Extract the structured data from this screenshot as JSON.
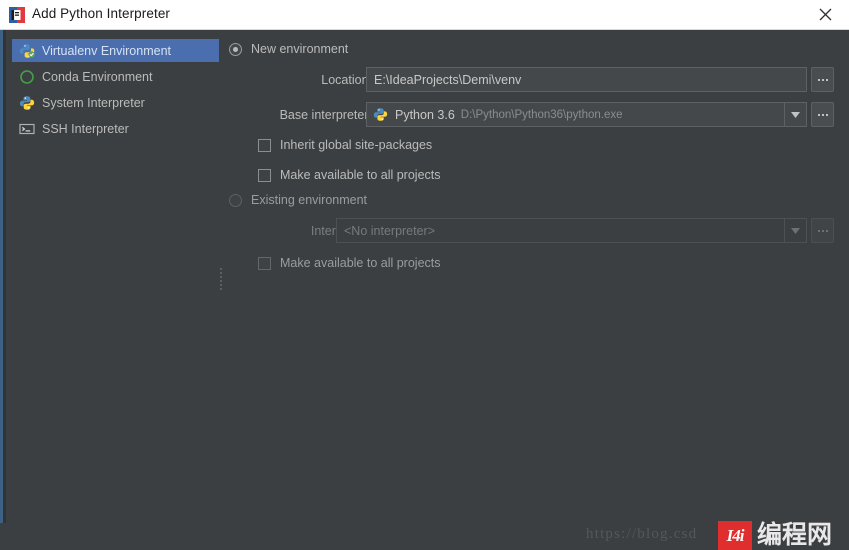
{
  "window": {
    "title": "Add Python Interpreter",
    "app_icon": "pycharm-icon",
    "close_label": "×"
  },
  "sidebar": {
    "items": [
      {
        "label": "Virtualenv Environment",
        "icon": "virtualenv-icon",
        "selected": true
      },
      {
        "label": "Conda Environment",
        "icon": "conda-icon",
        "selected": false
      },
      {
        "label": "System Interpreter",
        "icon": "python-icon",
        "selected": false
      },
      {
        "label": "SSH Interpreter",
        "icon": "ssh-terminal-icon",
        "selected": false
      }
    ]
  },
  "main": {
    "new_environment": {
      "radio_label": "New environment",
      "selected": true,
      "location": {
        "label": "Location:",
        "value": "E:\\IdeaProjects\\Demi\\venv",
        "browse_label": "..."
      },
      "base_interpreter": {
        "label": "Base interpreter:",
        "value": "Python 3.6",
        "path": "D:\\Python\\Python36\\python.exe",
        "icon": "python-icon",
        "browse_label": "..."
      },
      "checkboxes": [
        {
          "label": "Inherit global site-packages",
          "checked": false,
          "disabled": false
        },
        {
          "label": "Make available to all projects",
          "checked": false,
          "disabled": false
        }
      ]
    },
    "existing_environment": {
      "radio_label": "Existing environment",
      "selected": false,
      "interpreter": {
        "label": "Interpreter:",
        "value": "<No interpreter>",
        "browse_label": "..."
      },
      "checkboxes": [
        {
          "label": "Make available to all projects",
          "checked": false,
          "disabled": true
        }
      ]
    }
  },
  "watermark": {
    "url": "https://blog.csd",
    "logo_text": "I4i",
    "site_name": "编程网"
  },
  "colors": {
    "window_bg": "#3c3f41",
    "titlebar_bg": "#ffffff",
    "selection_blue": "#4b6eaf",
    "field_bg": "#45484a",
    "text": "#bbbbbb",
    "accent_edge": "#3d6185"
  }
}
